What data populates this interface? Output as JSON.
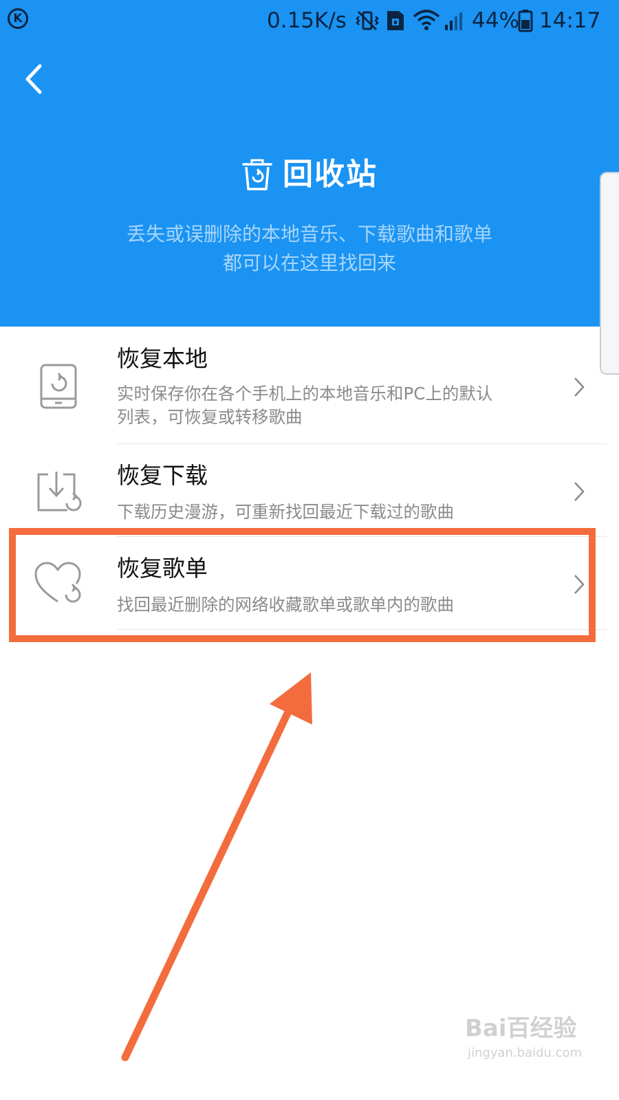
{
  "status_bar": {
    "carrier_logo": "K",
    "net_speed": "0.15K/s",
    "battery_percent": "44%",
    "time": "14:17",
    "icons": [
      "k-logo-icon",
      "vibrate-mute-icon",
      "sim-lock-icon",
      "wifi-icon",
      "cellular-signal-icon",
      "battery-icon"
    ]
  },
  "header": {
    "back_icon": "chevron-left-icon",
    "title_icon": "trash-restore-icon",
    "title": "回收站",
    "subtitle_line1": "丢失或误删除的本地音乐、下载歌曲和歌单",
    "subtitle_line2": "都可以在这里找回来",
    "background_color": "#1a93f3"
  },
  "options": [
    {
      "icon": "phone-restore-icon",
      "title": "恢复本地",
      "desc_line1": "实时保存你在各个手机上的本地音乐和PC上的默认",
      "desc_line2": "列表，可恢复或转移歌曲"
    },
    {
      "icon": "download-restore-icon",
      "title": "恢复下载",
      "desc_line1": "下载历史漫游，可重新找回最近下载过的歌曲"
    },
    {
      "icon": "heart-restore-icon",
      "title": "恢复歌单",
      "desc_line1": "找回最近删除的网络收藏歌单或歌单内的歌曲"
    }
  ],
  "annotation": {
    "highlight_color": "#f36c3e"
  },
  "watermark": {
    "logo": "Bai百经验",
    "url": "jingyan.baidu.com"
  }
}
